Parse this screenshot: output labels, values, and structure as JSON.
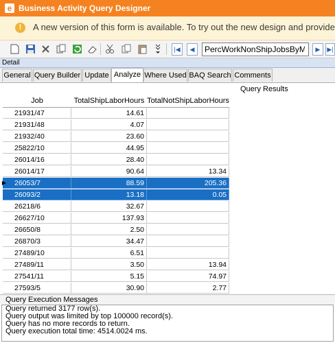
{
  "window": {
    "title": "Business Activity Query Designer"
  },
  "banner": {
    "message": "A new version of this form is available. To try out the new design and provide feedbac"
  },
  "toolbar": {
    "icons": [
      "new-icon",
      "save-icon",
      "delete-icon",
      "copy-icon",
      "refresh-icon",
      "clear-icon",
      "cut-icon",
      "copy-clip-icon",
      "paste-icon",
      "more-icon",
      "first-icon",
      "prev-icon",
      "next-icon",
      "last-icon"
    ],
    "query_select": "PercWorkNonShipJobsByMon"
  },
  "panel": {
    "label": "Detail"
  },
  "tabs": [
    "General",
    "Query Builder",
    "Update",
    "Analyze",
    "Where Used",
    "BAQ Search",
    "Comments"
  ],
  "active_tab": "Analyze",
  "results": {
    "label": "Query Results",
    "columns": [
      "Job",
      "TotalShipLaborHours",
      "TotalNotShipLaborHours"
    ],
    "rows": [
      {
        "job": "21931/47",
        "ship": "14.61",
        "notship": ""
      },
      {
        "job": "21931/48",
        "ship": "4.07",
        "notship": ""
      },
      {
        "job": "21932/40",
        "ship": "23.60",
        "notship": ""
      },
      {
        "job": "25822/10",
        "ship": "44.95",
        "notship": ""
      },
      {
        "job": "26014/16",
        "ship": "28.40",
        "notship": ""
      },
      {
        "job": "26014/17",
        "ship": "90.64",
        "notship": "13.34"
      },
      {
        "job": "26053/7",
        "ship": "88.59",
        "notship": "205.36",
        "selected": true
      },
      {
        "job": "26093/2",
        "ship": "13.18",
        "notship": "0.05",
        "selected": true
      },
      {
        "job": "26218/6",
        "ship": "32.67",
        "notship": ""
      },
      {
        "job": "26627/10",
        "ship": "137.93",
        "notship": ""
      },
      {
        "job": "26650/8",
        "ship": "2.50",
        "notship": ""
      },
      {
        "job": "26870/3",
        "ship": "34.47",
        "notship": ""
      },
      {
        "job": "27489/10",
        "ship": "6.51",
        "notship": ""
      },
      {
        "job": "27489/11",
        "ship": "3.50",
        "notship": "13.94"
      },
      {
        "job": "27541/11",
        "ship": "5.15",
        "notship": "74.97"
      },
      {
        "job": "27593/5",
        "ship": "30.90",
        "notship": "2.77"
      }
    ]
  },
  "messages": {
    "label": "Query Execution Messages",
    "lines": [
      "Query returned 3177 row(s).",
      "Query output was limited by top 100000 record(s).",
      "Query has no more records to return.",
      "Query execution total time: 4514.0024 ms."
    ]
  }
}
